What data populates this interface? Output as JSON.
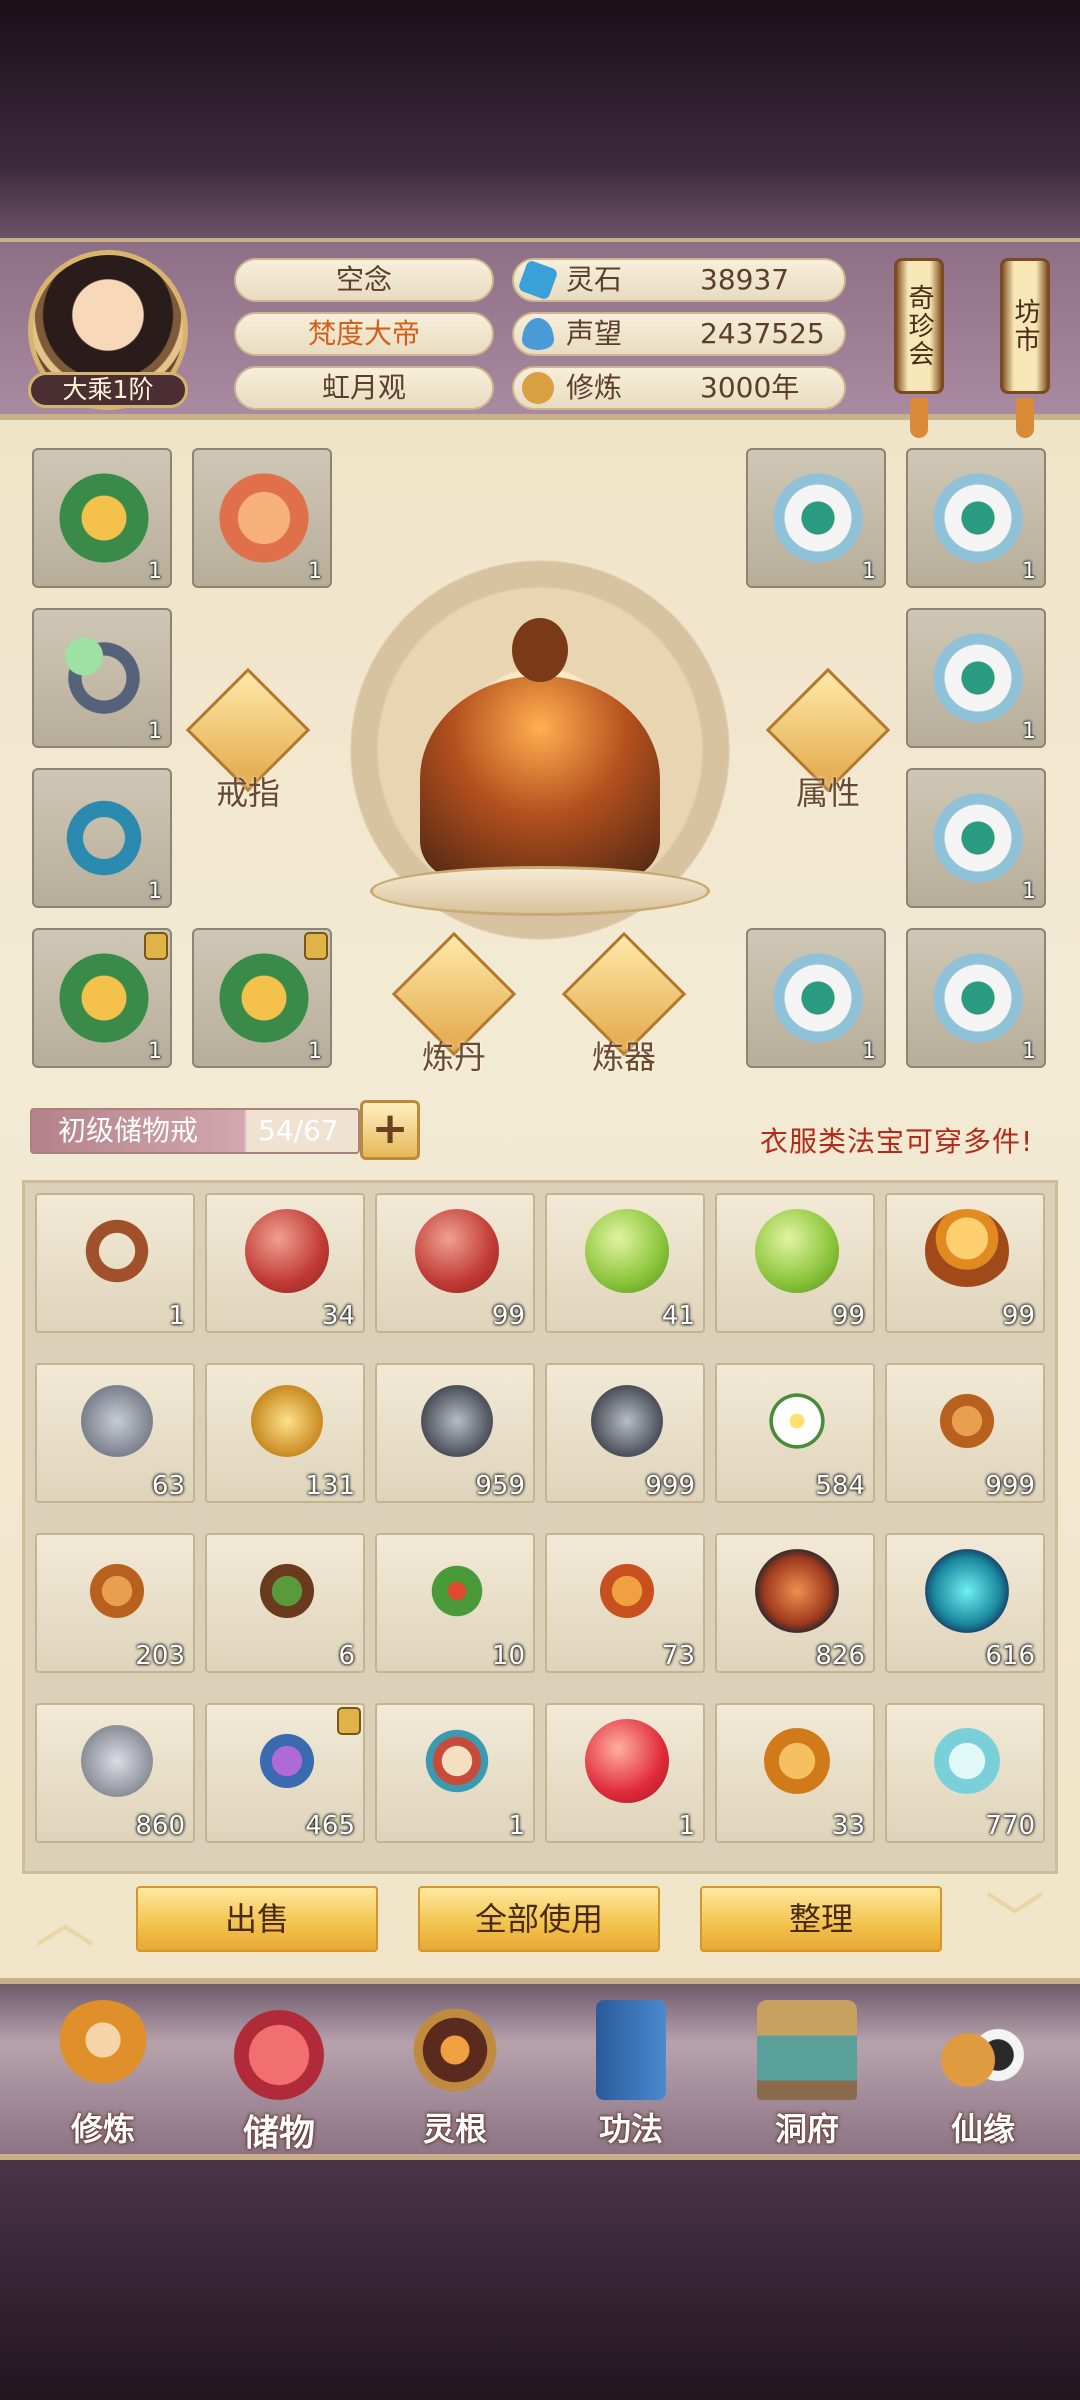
{
  "player": {
    "realm": "大乘1阶",
    "name": "空念",
    "title": "梵度大帝",
    "sect": "虹月观"
  },
  "stats": [
    {
      "icon": "spirit-stone-icon",
      "label": "灵石",
      "value": "38937",
      "color": "#3aa0d8"
    },
    {
      "icon": "prestige-icon",
      "label": "声望",
      "value": "2437525",
      "color": "#4a9ad8"
    },
    {
      "icon": "cultivation-icon",
      "label": "修炼",
      "value": "3000年",
      "color": "#d8a040"
    }
  ],
  "top_buttons": {
    "treasure_fair": "奇珍会",
    "market": "坊市"
  },
  "equipment": {
    "left_slots": [
      {
        "count": "1"
      },
      {
        "count": "1"
      },
      {
        "count": "1"
      },
      {
        "count": "1"
      },
      {
        "count": "1"
      },
      {
        "count": "1"
      }
    ],
    "right_slots": [
      {
        "count": "1"
      },
      {
        "count": "1"
      },
      {
        "count": "1"
      },
      {
        "count": "1"
      },
      {
        "count": "1"
      },
      {
        "count": "1"
      }
    ],
    "ring_label": "戒指",
    "attribute_label": "属性",
    "alchemy_label": "炼丹",
    "forge_label": "炼器"
  },
  "storage": {
    "name": "初级储物戒",
    "count": "54/67",
    "add": "+",
    "hint": "衣服类法宝可穿多件!"
  },
  "inventory": [
    {
      "count": "1"
    },
    {
      "count": "34"
    },
    {
      "count": "99"
    },
    {
      "count": "41"
    },
    {
      "count": "99"
    },
    {
      "count": "99"
    },
    {
      "count": "63"
    },
    {
      "count": "131"
    },
    {
      "count": "959"
    },
    {
      "count": "999"
    },
    {
      "count": "584"
    },
    {
      "count": "999"
    },
    {
      "count": "203"
    },
    {
      "count": "6"
    },
    {
      "count": "10"
    },
    {
      "count": "73"
    },
    {
      "count": "826"
    },
    {
      "count": "616"
    },
    {
      "count": "860"
    },
    {
      "count": "465"
    },
    {
      "count": "1"
    },
    {
      "count": "1"
    },
    {
      "count": "33"
    },
    {
      "count": "770"
    }
  ],
  "actions": {
    "sell": "出售",
    "use_all": "全部使用",
    "sort": "整理",
    "up": "︿",
    "down": "﹀"
  },
  "nav": [
    {
      "label": "修炼"
    },
    {
      "label": "储物"
    },
    {
      "label": "灵根"
    },
    {
      "label": "功法"
    },
    {
      "label": "洞府"
    },
    {
      "label": "仙缘"
    }
  ]
}
